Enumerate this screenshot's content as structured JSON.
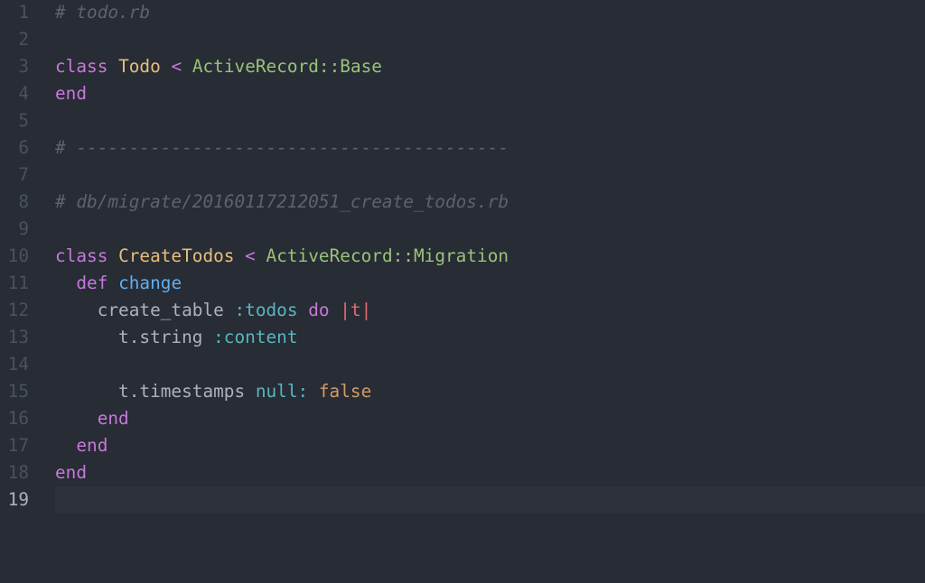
{
  "editor": {
    "language": "ruby",
    "theme_colors": {
      "background": "#282c34",
      "active_line": "#2c313a",
      "gutter_text": "#495162",
      "gutter_active": "#abb2bf"
    },
    "active_line_number": 19,
    "lines": [
      {
        "number": "1",
        "tokens": [
          {
            "type": "comment",
            "text": "# todo.rb"
          }
        ]
      },
      {
        "number": "2",
        "tokens": []
      },
      {
        "number": "3",
        "tokens": [
          {
            "type": "keyword",
            "text": "class"
          },
          {
            "type": "plain",
            "text": " "
          },
          {
            "type": "class",
            "text": "Todo"
          },
          {
            "type": "plain",
            "text": " "
          },
          {
            "type": "operator",
            "text": "<"
          },
          {
            "type": "plain",
            "text": " "
          },
          {
            "type": "superclass",
            "text": "ActiveRecord::Base"
          }
        ]
      },
      {
        "number": "4",
        "tokens": [
          {
            "type": "keyword",
            "text": "end"
          }
        ]
      },
      {
        "number": "5",
        "tokens": []
      },
      {
        "number": "6",
        "tokens": [
          {
            "type": "comment",
            "text": "# -----------------------------------------"
          }
        ]
      },
      {
        "number": "7",
        "tokens": []
      },
      {
        "number": "8",
        "tokens": [
          {
            "type": "comment",
            "text": "# db/migrate/20160117212051_create_todos.rb"
          }
        ]
      },
      {
        "number": "9",
        "tokens": []
      },
      {
        "number": "10",
        "tokens": [
          {
            "type": "keyword",
            "text": "class"
          },
          {
            "type": "plain",
            "text": " "
          },
          {
            "type": "class",
            "text": "CreateTodos"
          },
          {
            "type": "plain",
            "text": " "
          },
          {
            "type": "operator",
            "text": "<"
          },
          {
            "type": "plain",
            "text": " "
          },
          {
            "type": "superclass",
            "text": "ActiveRecord::Migration"
          }
        ]
      },
      {
        "number": "11",
        "tokens": [
          {
            "type": "plain",
            "text": "  "
          },
          {
            "type": "keyword",
            "text": "def"
          },
          {
            "type": "plain",
            "text": " "
          },
          {
            "type": "function",
            "text": "change"
          }
        ]
      },
      {
        "number": "12",
        "tokens": [
          {
            "type": "plain",
            "text": "    create_table "
          },
          {
            "type": "symbol",
            "text": ":todos"
          },
          {
            "type": "plain",
            "text": " "
          },
          {
            "type": "keyword",
            "text": "do"
          },
          {
            "type": "plain",
            "text": " "
          },
          {
            "type": "pipe",
            "text": "|"
          },
          {
            "type": "variable",
            "text": "t"
          },
          {
            "type": "pipe",
            "text": "|"
          }
        ]
      },
      {
        "number": "13",
        "tokens": [
          {
            "type": "plain",
            "text": "      t.string "
          },
          {
            "type": "symbol",
            "text": ":content"
          }
        ]
      },
      {
        "number": "14",
        "tokens": []
      },
      {
        "number": "15",
        "tokens": [
          {
            "type": "plain",
            "text": "      t.timestamps "
          },
          {
            "type": "symbol",
            "text": "null:"
          },
          {
            "type": "plain",
            "text": " "
          },
          {
            "type": "boolean",
            "text": "false"
          }
        ]
      },
      {
        "number": "16",
        "tokens": [
          {
            "type": "plain",
            "text": "    "
          },
          {
            "type": "keyword",
            "text": "end"
          }
        ]
      },
      {
        "number": "17",
        "tokens": [
          {
            "type": "plain",
            "text": "  "
          },
          {
            "type": "keyword",
            "text": "end"
          }
        ]
      },
      {
        "number": "18",
        "tokens": [
          {
            "type": "keyword",
            "text": "end"
          }
        ]
      },
      {
        "number": "19",
        "tokens": []
      }
    ]
  }
}
